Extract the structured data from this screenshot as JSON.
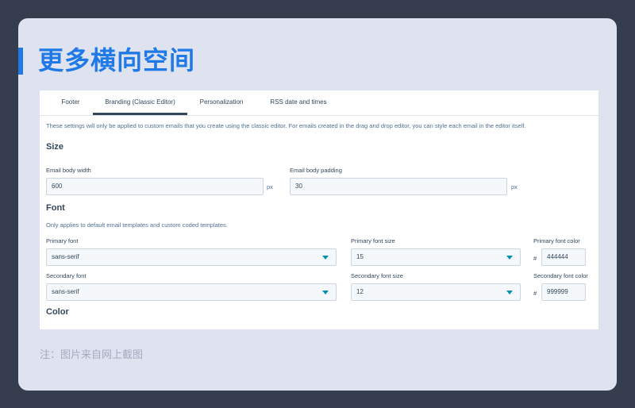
{
  "heading": "更多横向空间",
  "tabs": [
    {
      "label": "Footer"
    },
    {
      "label": "Branding (Classic Editor)"
    },
    {
      "label": "Personalization"
    },
    {
      "label": "RSS date and times"
    }
  ],
  "description": "These settings will only be applied to custom emails that you create using the classic editor. For emails created in the drag and drop editor, you can style each email in the editor itself.",
  "size": {
    "title": "Size",
    "body_width": {
      "label": "Email body width",
      "value": "600",
      "unit": "px"
    },
    "body_padding": {
      "label": "Email body padding",
      "value": "30",
      "unit": "px"
    }
  },
  "font": {
    "title": "Font",
    "note": "Only applies to default email templates and custom coded templates.",
    "primary_font": {
      "label": "Primary font",
      "value": "sans-serif"
    },
    "primary_size": {
      "label": "Primary font size",
      "value": "15"
    },
    "primary_color": {
      "label": "Primary font color",
      "prefix": "#",
      "value": "444444"
    },
    "secondary_font": {
      "label": "Secondary font",
      "value": "sans-serif"
    },
    "secondary_size": {
      "label": "Secondary font size",
      "value": "12"
    },
    "secondary_color": {
      "label": "Secondary font color",
      "prefix": "#",
      "value": "999999"
    }
  },
  "color": {
    "title": "Color"
  },
  "footnote": "注：图片来自网上截图",
  "colors": {
    "accent": "#1f7ae8",
    "text": "#33475b",
    "caret": "#0091ae"
  }
}
